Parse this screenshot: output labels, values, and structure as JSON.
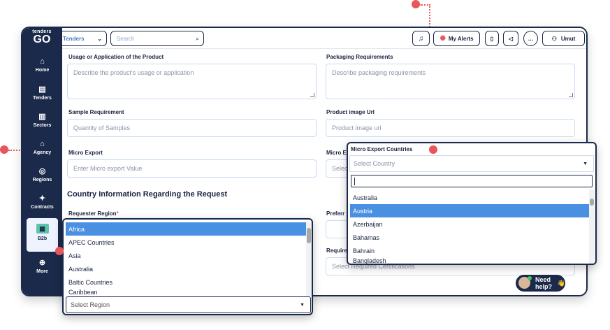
{
  "brand": {
    "line1": "tenders",
    "line2": "GO"
  },
  "sidebar": {
    "items": [
      {
        "label": "Home",
        "icon": "home-icon",
        "glyph": "⌂"
      },
      {
        "label": "Tenders",
        "icon": "tenders-icon",
        "glyph": "▤"
      },
      {
        "label": "Sectors",
        "icon": "sectors-icon",
        "glyph": "▥"
      },
      {
        "label": "Agency",
        "icon": "agency-icon",
        "glyph": "⌂"
      },
      {
        "label": "Regions",
        "icon": "regions-icon",
        "glyph": "◎"
      },
      {
        "label": "Contracts",
        "icon": "contracts-icon",
        "glyph": "✦"
      },
      {
        "label": "B2b",
        "icon": "b2b-icon",
        "glyph": "▦"
      },
      {
        "label": "More",
        "icon": "globe-icon",
        "glyph": "⊕"
      }
    ]
  },
  "topbar": {
    "dropdown_value": "Tenders",
    "search_placeholder": "Search",
    "alerts_label": "My Alerts",
    "user_name": "Umut"
  },
  "form": {
    "usage_label": "Usage or Application of the Product",
    "usage_placeholder": "Describe the product's usage or application",
    "packaging_label": "Packaging Requirements",
    "packaging_placeholder": "Describe packaging requirements",
    "sample_label": "Sample Requirement",
    "sample_placeholder": "Quantity of Samples",
    "image_label": "Product image Url",
    "image_placeholder": "Product image url",
    "micro_export_label": "Micro Export",
    "micro_export_placeholder": "Enter Micro export Value",
    "micro_countries_label_partial": "Micro E",
    "micro_countries_value_partial": "Selec",
    "section_title": "Country Information Regarding the Request",
    "requester_region_label": "Requester Region",
    "required_mark": "*",
    "preferred_label_partial": "Preferr",
    "required_label_partial": "Require",
    "certifications_placeholder": "Select Required Certifications"
  },
  "region_dropdown": {
    "options": [
      "Africa",
      "APEC Countries",
      "Asia",
      "Australia",
      "Baltic Countries",
      "Caribbean"
    ],
    "selected_index": 0,
    "placeholder": "Select Region"
  },
  "country_dropdown": {
    "title": "Micro Export Countries",
    "placeholder": "Select Country",
    "search_value": "",
    "options": [
      "Australia",
      "Austria",
      "Azerbaijan",
      "Bahamas",
      "Bahrain",
      "Bangladesh"
    ],
    "selected_index": 1,
    "peek_text": "Select Required Certifications"
  },
  "help": {
    "label": "Need help?",
    "emoji": "👋"
  },
  "colors": {
    "navy": "#1b2a4a",
    "accent_red": "#e8555a",
    "select_blue": "#4a90e2",
    "field_border": "#c9dbf0",
    "b2b_green": "#5ec4a9"
  }
}
